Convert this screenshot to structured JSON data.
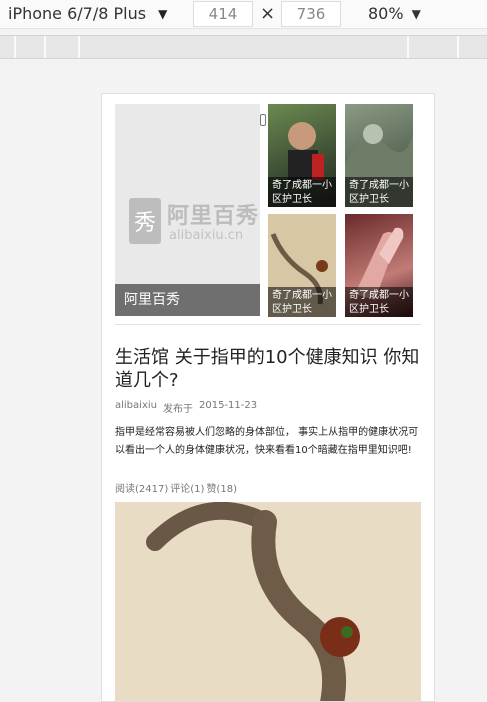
{
  "devtools": {
    "device": "iPhone 6/7/8 Plus",
    "width": "414",
    "height": "736",
    "times": "×",
    "zoom": "80%",
    "chevron": "▼"
  },
  "tiles": {
    "large": {
      "logo_mark": "秀",
      "logo_cn": "阿里百秀",
      "logo_en": "alibaixiu.cn",
      "caption": "阿里百秀"
    },
    "small": [
      {
        "caption": "奇了成都一小区护卫长"
      },
      {
        "caption": "奇了成都一小区护卫长"
      },
      {
        "caption": "奇了成都一小区护卫长"
      },
      {
        "caption": "奇了成都一小区护卫长"
      }
    ]
  },
  "article": {
    "title": "生活馆 关于指甲的10个健康知识 你知道几个?",
    "author": "alibaixiu",
    "published_label": "发布于",
    "date": "2015-11-23",
    "summary": "指甲是经常容易被人们忽略的身体部位， 事实上从指甲的健康状况可以看出一个人的身体健康状况，快来看看10个暗藏在指甲里知识吧!",
    "stats": {
      "reads": "阅读(2417)",
      "comments": "评论(1)",
      "likes": "赞(18)"
    }
  }
}
